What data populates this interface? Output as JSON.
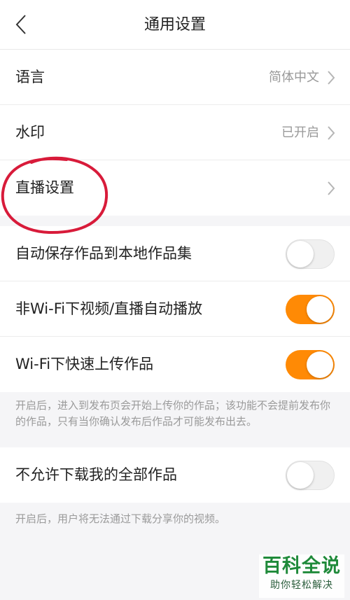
{
  "header": {
    "title": "通用设置",
    "back_icon": "chevron-left-icon"
  },
  "group1": {
    "language": {
      "label": "语言",
      "value": "简体中文"
    },
    "watermark": {
      "label": "水印",
      "value": "已开启"
    },
    "live": {
      "label": "直播设置",
      "value": ""
    }
  },
  "group2": {
    "autosave": {
      "label": "自动保存作品到本地作品集",
      "enabled": false
    },
    "autoplay": {
      "label": "非Wi-Fi下视频/直播自动播放",
      "enabled": true
    },
    "fastupload": {
      "label": "Wi-Fi下快速上传作品",
      "enabled": true
    },
    "note": "开启后，进入到发布页会开始上传你的作品；该功能不会提前发布你的作品，只有当你确认发布后作品才可能发布出去。"
  },
  "group3": {
    "nodownload": {
      "label": "不允许下载我的全部作品",
      "enabled": false
    },
    "note": "开启后，用户将无法通过下载分享你的视频。"
  },
  "watermark_logo": {
    "main": "百科全说",
    "sub": "助你轻松解决"
  },
  "colors": {
    "accent": "#ff8a05",
    "annotation": "#d81b3a"
  }
}
